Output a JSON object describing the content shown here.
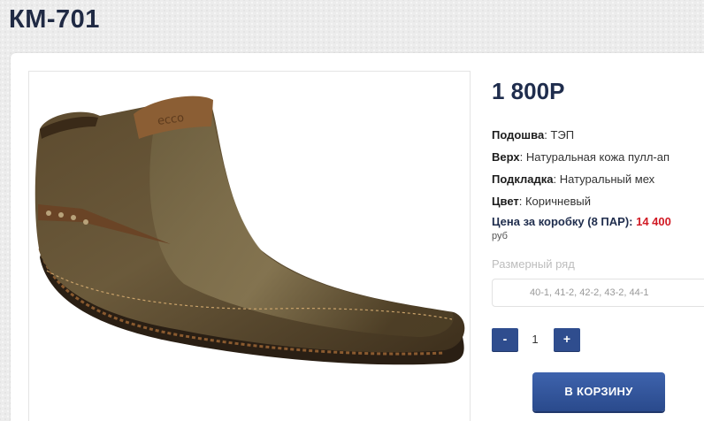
{
  "product": {
    "title": "КМ-701",
    "price": "1 800Р",
    "image_alt": "brown leather ankle boot"
  },
  "specs": [
    {
      "label": "Подошва",
      "value": "ТЭП"
    },
    {
      "label": "Верх",
      "value": "Натуральная кожа пулл-ап"
    },
    {
      "label": "Подкладка",
      "value": "Натуральный мех"
    },
    {
      "label": "Цвет",
      "value": "Коричневый"
    }
  ],
  "box_price": {
    "label": "Цена за коробку (8 ПАР):",
    "value": "14 400",
    "unit": "руб"
  },
  "sizes": {
    "label": "Размерный ряд",
    "value": "40-1, 41-2, 42-2, 43-2, 44-1"
  },
  "quantity": {
    "minus": "-",
    "value": "1",
    "plus": "+"
  },
  "cart": {
    "button_label": "В КОРЗИНУ"
  },
  "colors": {
    "accent": "#2f4d8e",
    "price_red": "#d11b25",
    "title": "#202a44"
  }
}
